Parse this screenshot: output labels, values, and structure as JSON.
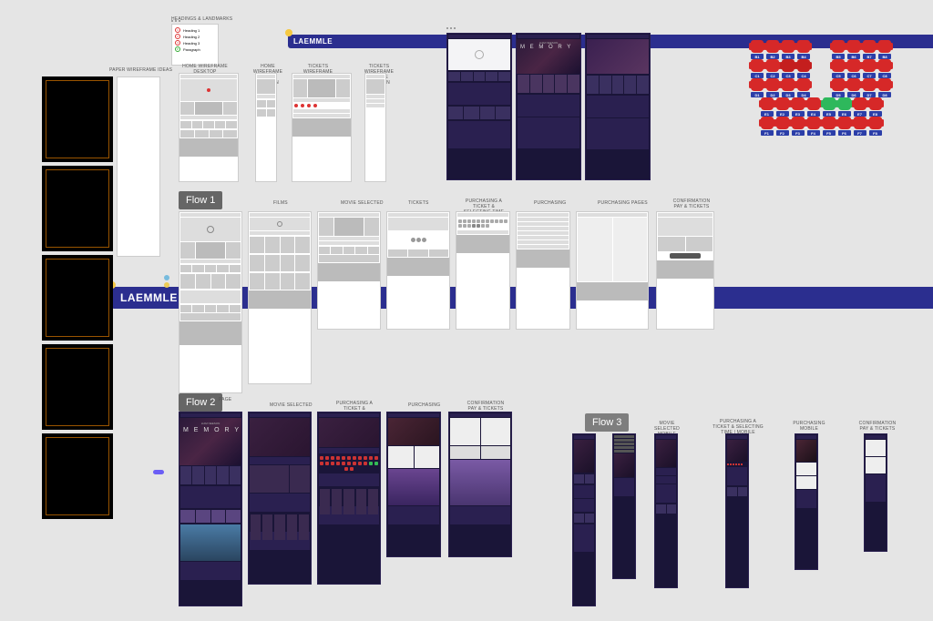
{
  "headings_panel": {
    "title": "HEADINGS & LANDMARKS",
    "rows": [
      "Heading 1",
      "Heading 2",
      "Heading 3",
      "Paragraph"
    ]
  },
  "brand": "LAEMMLE",
  "paper_label": "PAPER WIREFRAME IDEAS",
  "wire_labels": {
    "home_desktop": "HOME WIREFRAME DESKTOP VERSION",
    "home_mobile": "HOME WIREFRAME MOBILE VERSION",
    "tickets_desktop": "TICKETS WIREFRAME DESKTOP VERSION",
    "tickets_mobile": "TICKETS WIREFRAME MOBILE VERSION"
  },
  "flows": {
    "f1": "Flow 1",
    "f2": "Flow 2",
    "f3": "Flow 3"
  },
  "flow1_labels": {
    "films": "FILMS",
    "movie_selected": "MOVIE SELECTED",
    "tickets": "TICKETS",
    "purchasing_time": "PURCHASING A TICKET & SELECTING TIME",
    "purchasing": "PURCHASING",
    "purchasing_pages": "PURCHASING PAGES",
    "confirmation": "CONFIRMATION PAY & TICKETS"
  },
  "flow2_labels": {
    "page": "PAGE",
    "movie_selected": "MOVIE SELECTED",
    "purchasing_time": "PURCHASING A TICKET & SELECTING TIME",
    "purchasing": "PURCHASING",
    "confirmation": "CONFIRMATION PAY & TICKETS"
  },
  "flow3_labels": {
    "movie_selected": "MOVIE SELECTED MOBILE",
    "purchasing_time": "PURCHASING A TICKET & SELECTING TIME | MOBILE",
    "purchasing": "PURCHASING MOBILE",
    "confirmation": "CONFIRMATION PAY & TICKETS"
  },
  "hero_title": "M E M O R Y",
  "hero_sub": "LIAM NEESON",
  "seating": {
    "rows": [
      {
        "letter": "B",
        "count": 8,
        "split": true,
        "colors": [
          "red",
          "red",
          "red",
          "red",
          "red",
          "red",
          "red",
          "red"
        ]
      },
      {
        "letter": "C",
        "count": 8,
        "split": true,
        "colors": [
          "red",
          "red",
          "redb",
          "redb",
          "red",
          "red",
          "red",
          "red"
        ]
      },
      {
        "letter": "D",
        "count": 8,
        "split": true,
        "colors": [
          "red",
          "red",
          "red",
          "red",
          "red",
          "red",
          "red",
          "red"
        ]
      },
      {
        "letter": "E",
        "count": 8,
        "split": false,
        "colors": [
          "red",
          "red",
          "red",
          "red",
          "green",
          "green",
          "red",
          "red"
        ]
      },
      {
        "letter": "F",
        "count": 8,
        "split": false,
        "colors": [
          "red",
          "red",
          "red",
          "red",
          "red",
          "red",
          "red",
          "red"
        ]
      }
    ]
  }
}
